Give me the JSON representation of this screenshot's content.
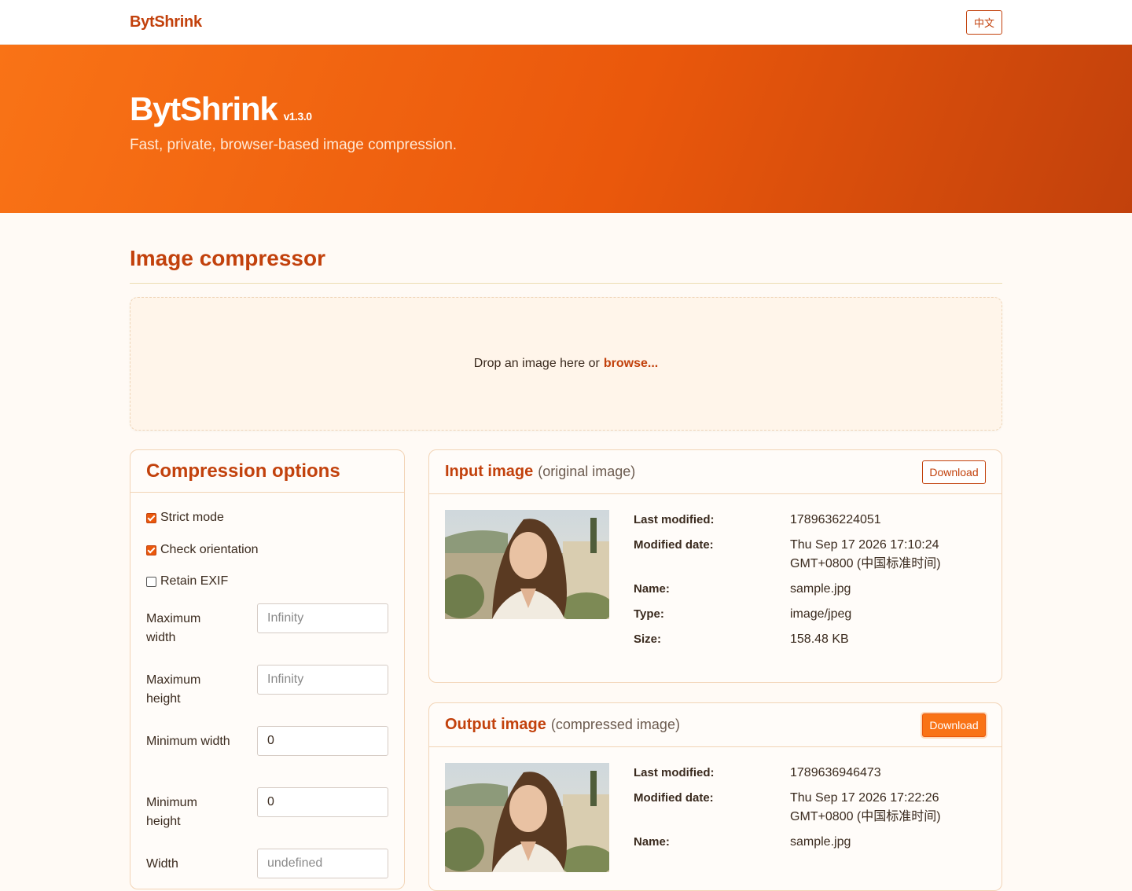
{
  "topbar": {
    "brand": "BytShrink",
    "lang_button": "中文"
  },
  "hero": {
    "title": "BytShrink",
    "version": "v1.3.0",
    "subtitle": "Fast, private, browser-based image compression."
  },
  "main": {
    "title": "Image compressor",
    "dropzone": {
      "text": "Drop an image here or",
      "browse": "browse..."
    }
  },
  "options": {
    "title": "Compression options",
    "checks": [
      {
        "label": "Strict mode",
        "checked": true
      },
      {
        "label": "Check orientation",
        "checked": true
      },
      {
        "label": "Retain EXIF",
        "checked": false
      }
    ],
    "fields": [
      {
        "label": "Maximum width",
        "value": "",
        "placeholder": "Infinity"
      },
      {
        "label": "Maximum height",
        "value": "",
        "placeholder": "Infinity"
      },
      {
        "label": "Minimum width",
        "value": "0",
        "placeholder": ""
      },
      {
        "label": "Minimum height",
        "value": "0",
        "placeholder": ""
      },
      {
        "label": "Width",
        "value": "",
        "placeholder": "undefined"
      }
    ]
  },
  "input_image": {
    "title": "Input image",
    "subtitle": "(original image)",
    "download": "Download",
    "meta": {
      "last_modified_label": "Last modified:",
      "last_modified": "1789636224051",
      "modified_date_label": "Modified date:",
      "modified_date": "Thu Sep 17 2026 17:10:24 GMT+0800 (中国标准时间)",
      "name_label": "Name:",
      "name": "sample.jpg",
      "type_label": "Type:",
      "type": "image/jpeg",
      "size_label": "Size:",
      "size": "158.48 KB"
    }
  },
  "output_image": {
    "title": "Output image",
    "subtitle": "(compressed image)",
    "download": "Download",
    "meta": {
      "last_modified_label": "Last modified:",
      "last_modified": "1789636946473",
      "modified_date_label": "Modified date:",
      "modified_date": "Thu Sep 17 2026 17:22:26 GMT+0800 (中国标准时间)",
      "name_label": "Name:",
      "name": "sample.jpg"
    }
  },
  "colors": {
    "accent": "#c2410c",
    "accent_bright": "#f97316",
    "background": "#fffaf5"
  }
}
